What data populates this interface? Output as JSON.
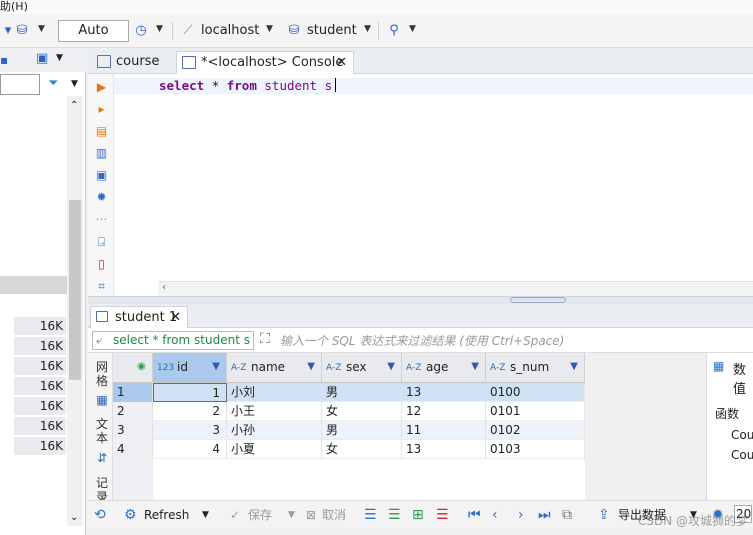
{
  "menu": {
    "help": "助(H)"
  },
  "toolbar": {
    "transaction_mode": "Auto",
    "datasource": "localhost",
    "database": "student"
  },
  "navigator": {
    "sizes": [
      "16K",
      "16K",
      "16K",
      "16K",
      "16K",
      "16K",
      "16K"
    ]
  },
  "tabs": [
    {
      "label": "course"
    },
    {
      "label": "*<localhost> Console"
    }
  ],
  "editor": {
    "sql": [
      "select",
      "*",
      "from",
      "student",
      "s"
    ]
  },
  "results": {
    "tab_label": "student 1",
    "filter_query": "select * from student s",
    "filter_placeholder": "输入一个 SQL 表达式来过滤结果 (使用 Ctrl+Space)",
    "side_labels": [
      "网格",
      "文本",
      "记录"
    ],
    "columns": [
      {
        "type": "123",
        "name": "id"
      },
      {
        "type": "A-Z",
        "name": "name"
      },
      {
        "type": "A-Z",
        "name": "sex"
      },
      {
        "type": "A-Z",
        "name": "age"
      },
      {
        "type": "A-Z",
        "name": "s_num"
      }
    ],
    "rows": [
      {
        "n": "1",
        "id": "1",
        "name": "小刘",
        "sex": "男",
        "age": "13",
        "s_num": "0100"
      },
      {
        "n": "2",
        "id": "2",
        "name": "小王",
        "sex": "女",
        "age": "12",
        "s_num": "0101"
      },
      {
        "n": "3",
        "id": "3",
        "name": "小孙",
        "sex": "男",
        "age": "11",
        "s_num": "0102"
      },
      {
        "n": "4",
        "id": "4",
        "name": "小夏",
        "sex": "女",
        "age": "13",
        "s_num": "0103"
      }
    ]
  },
  "right_panel": {
    "title": "数值",
    "section": "函数",
    "items": [
      "Cou",
      "Cou"
    ]
  },
  "bottom": {
    "refresh": "Refresh",
    "save": "保存",
    "cancel": "取消",
    "export": "导出数据",
    "page_size": "20"
  },
  "watermark": "CSDN @攻城狮的梦"
}
